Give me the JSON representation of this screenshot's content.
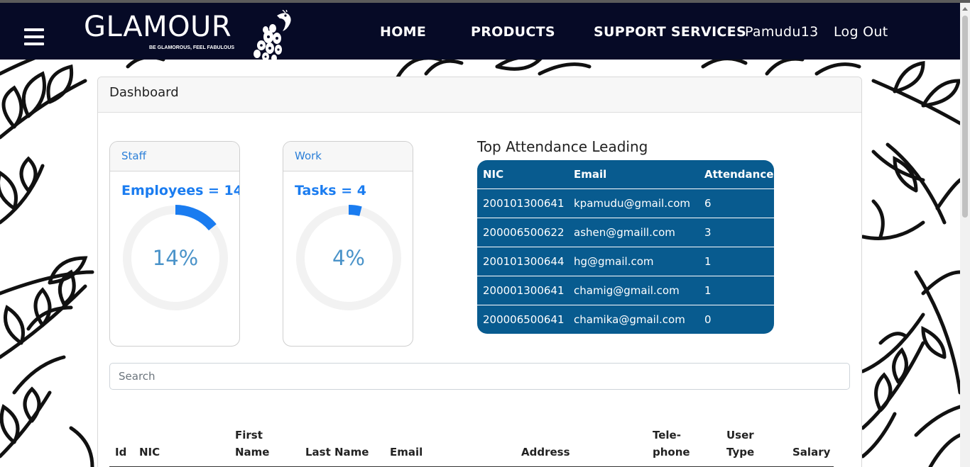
{
  "nav": {
    "brand": "GLAMOUR",
    "tagline": "BE GLAMOROUS, FEEL FABULOUS",
    "links": [
      "HOME",
      "PRODUCTS",
      "SUPPORT SERVICES"
    ],
    "username": "Pamudu13",
    "logout": "Log Out"
  },
  "dashboard": {
    "title": "Dashboard",
    "staff": {
      "header": "Staff",
      "stat": "Employees = 14",
      "percent_label": "14%",
      "fraction": 0.14
    },
    "work": {
      "header": "Work",
      "stat": "Tasks = 4",
      "percent_label": "4%",
      "fraction": 0.04
    },
    "ring_colors": {
      "track": "#f2f2f2",
      "fill": "#1a7cf0",
      "text": "#4a93c9"
    }
  },
  "attendance": {
    "title": "Top Attendance Leading",
    "headers": [
      "NIC",
      "Email",
      "Attendance"
    ],
    "rows": [
      [
        "200101300641",
        "kpamudu@gmail.com",
        "6"
      ],
      [
        "200006500622",
        "ashen@gmaill.com",
        "3"
      ],
      [
        "200101300644",
        "hg@gmail.com",
        "1"
      ],
      [
        "200001300641",
        "chamig@gmail.com",
        "1"
      ],
      [
        "200006500641",
        "chamika@gmail.com",
        "0"
      ]
    ],
    "bg_color": "#085b8f"
  },
  "search": {
    "placeholder": "Search"
  },
  "table": {
    "headers": {
      "id": "Id",
      "nic": "NIC",
      "first_name_1": "First",
      "first_name_2": "Name",
      "last_name": "Last Name",
      "email": "Email",
      "address": "Address",
      "telephone_1": "Tele-",
      "telephone_2": "phone",
      "user_type_1": "User",
      "user_type_2": "Type",
      "salary": "Salary"
    }
  },
  "colors": {
    "navbar": "#060a26",
    "accent": "#1a7cf0"
  }
}
